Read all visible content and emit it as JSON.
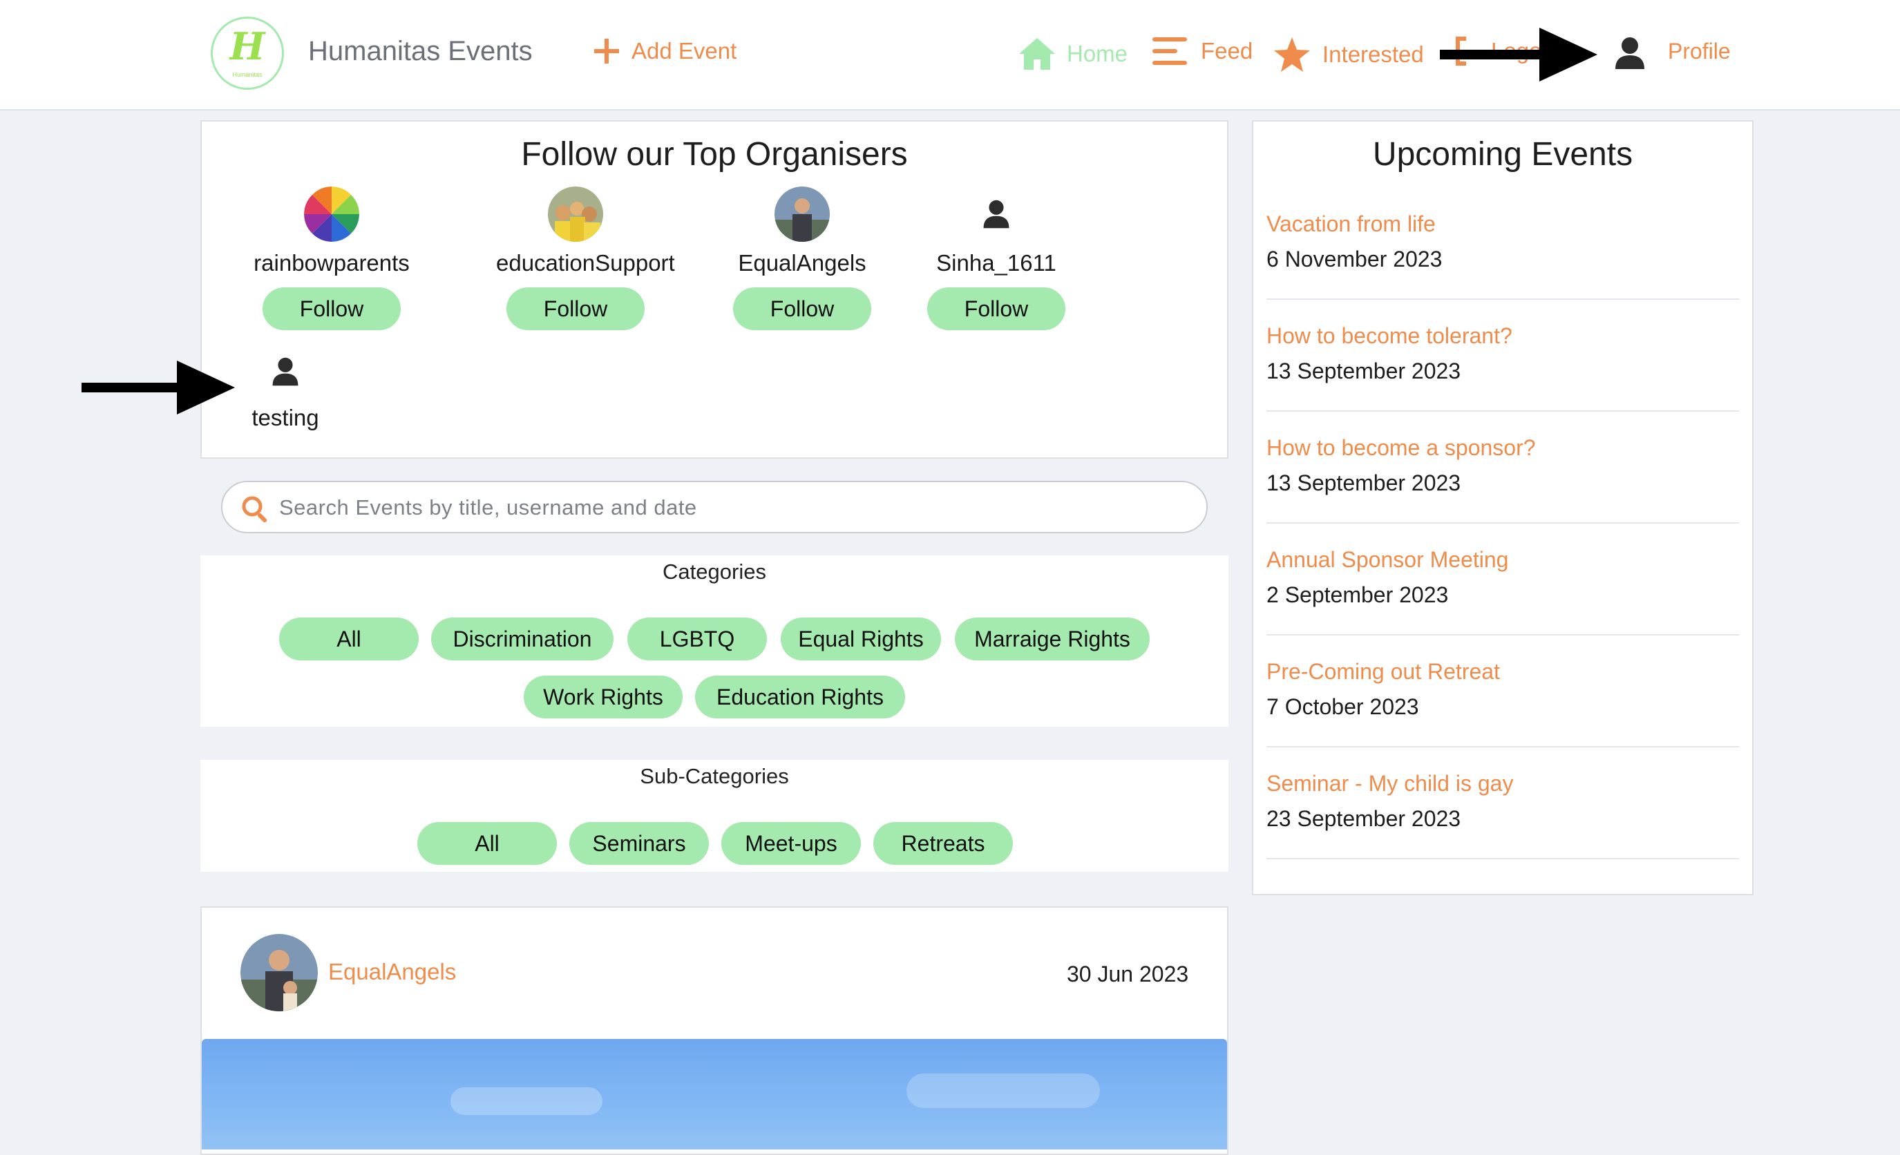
{
  "header": {
    "brand_title": "Humanitas Events",
    "logo_letter": "H",
    "logo_subtext": "Humanitas",
    "add_event_label": "Add Event",
    "nav": {
      "home": "Home",
      "feed": "Feed",
      "interested": "Interested",
      "logout": "Logout",
      "profile": "Profile"
    }
  },
  "organisers": {
    "title": "Follow our Top Organisers",
    "follow_label": "Follow",
    "items": [
      {
        "name": "rainbowparents",
        "avatar": "rainbow-wheel"
      },
      {
        "name": "educationSupport",
        "avatar": "group-photo"
      },
      {
        "name": "EqualAngels",
        "avatar": "person-photo"
      },
      {
        "name": "Sinha_1611",
        "avatar": "user-placeholder-icon"
      },
      {
        "name": "testing",
        "avatar": "user-placeholder-icon"
      }
    ]
  },
  "search": {
    "placeholder": "Search Events by title, username and date"
  },
  "categories": {
    "title": "Categories",
    "items": [
      "All",
      "Discrimination",
      "LGBTQ",
      "Equal Rights",
      "Marraige Rights",
      "Work Rights",
      "Education Rights"
    ]
  },
  "subcategories": {
    "title": "Sub-Categories",
    "items": [
      "All",
      "Seminars",
      "Meet-ups",
      "Retreats"
    ]
  },
  "upcoming": {
    "title": "Upcoming Events",
    "events": [
      {
        "title": "Vacation from life",
        "date": "6 November 2023"
      },
      {
        "title": "How to become tolerant?",
        "date": "13 September 2023"
      },
      {
        "title": "How to become a sponsor?",
        "date": "13 September 2023"
      },
      {
        "title": "Annual Sponsor Meeting",
        "date": "2 September 2023"
      },
      {
        "title": "Pre-Coming out Retreat",
        "date": "7 October 2023"
      },
      {
        "title": "Seminar - My child is gay",
        "date": "23 September 2023"
      }
    ]
  },
  "post": {
    "author": "EqualAngels",
    "date": "30 Jun 2023"
  },
  "colors": {
    "accent_orange": "#ef8c4c",
    "accent_green": "#a4e9ae",
    "page_bg": "#eef2f6"
  }
}
